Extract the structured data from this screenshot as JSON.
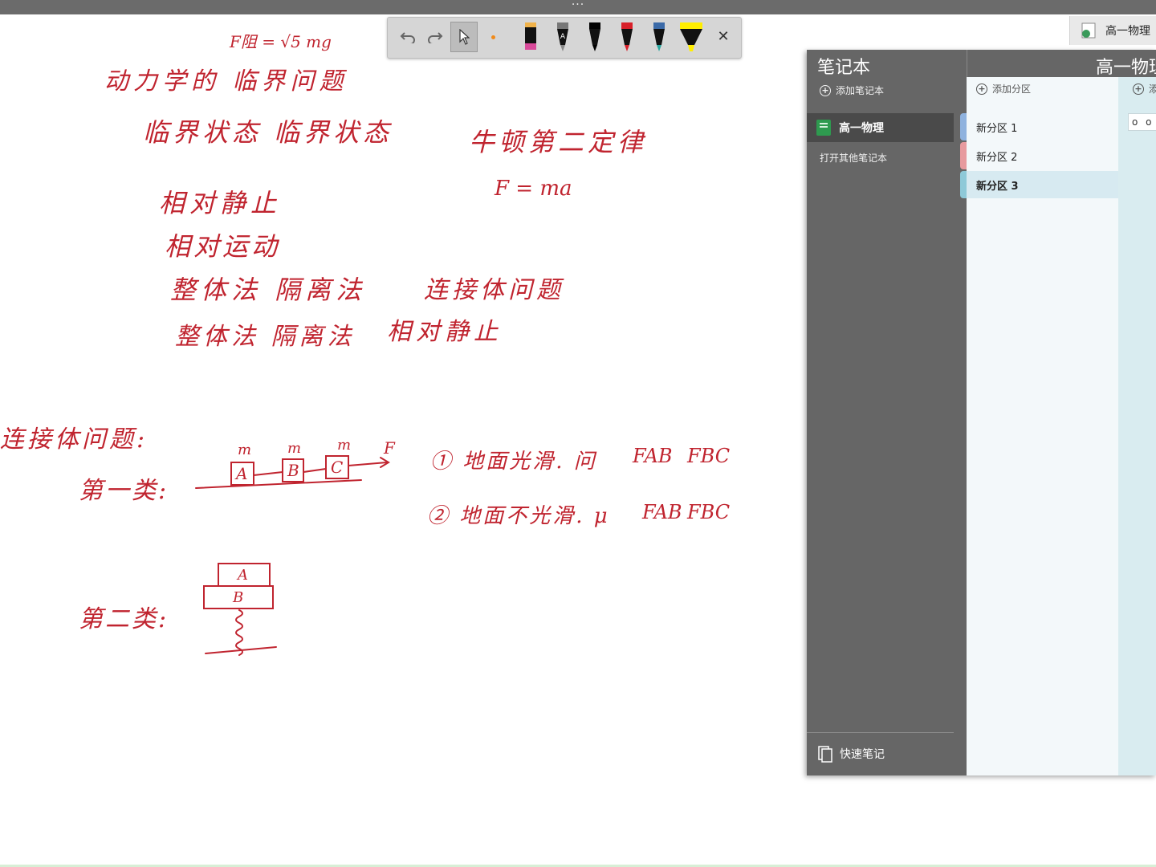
{
  "window": {
    "title_handle": "···"
  },
  "ink_notes": {
    "formula_top": "F阻 = √5 mg",
    "title": "动力学的 临界问题",
    "line_critical": "临界状态  临界状态",
    "newton_law": "牛顿第二定律",
    "rel_static": "相对静止",
    "f_ma": "F = ma",
    "rel_motion": "相对运动",
    "methods_1": "整体法  隔离法",
    "connected_problem": "连接体问题",
    "methods_2": "整体法  隔离法",
    "rel_static_2": "相对静止",
    "connected_heading": "连接体问题:",
    "type_1": "第一类:",
    "type_2": "第二类:",
    "case_smooth": "① 地面光滑. 问",
    "case_rough": "② 地面不光滑. μ",
    "f_ab_1": "FAB",
    "f_bc_1": "FBC",
    "f_ab_2": "FAB",
    "f_bc_2": "FBC",
    "mass_label": "m",
    "force_label": "F",
    "block_a": "A",
    "block_b": "B",
    "block_c": "C",
    "ink_color": "#c0242f"
  },
  "pen_toolbar": {
    "undo_icon": "undo-icon",
    "redo_icon": "redo-icon",
    "select_icon": "cursor-icon",
    "pens": [
      {
        "name": "pen-pink",
        "color": "#d94a9a"
      },
      {
        "name": "pen-a",
        "color": "#222222"
      },
      {
        "name": "pen-black",
        "color": "#000000"
      },
      {
        "name": "pen-red",
        "color": "#d8202a"
      },
      {
        "name": "pen-teal",
        "color": "#2aa7a0"
      },
      {
        "name": "highlighter-yellow",
        "color": "#ffee00"
      }
    ],
    "close_label": "✕"
  },
  "corner_title": {
    "label": "高一物理"
  },
  "notebook_panel": {
    "header": "笔记本",
    "add_notebook": "添加笔记本",
    "current_notebook": "高一物理",
    "open_other": "打开其他笔记本",
    "quick_notes": "快速笔记",
    "section_header": "高一物理",
    "add_section": "添加分区",
    "add_page_truncated": "添",
    "sections": [
      {
        "label": "新分区 1",
        "color": "#8fb2de"
      },
      {
        "label": "新分区 2",
        "color": "#e79a9e"
      },
      {
        "label": "新分区 3",
        "color": "#8ec9d8"
      }
    ],
    "page_search_text": "o o"
  }
}
